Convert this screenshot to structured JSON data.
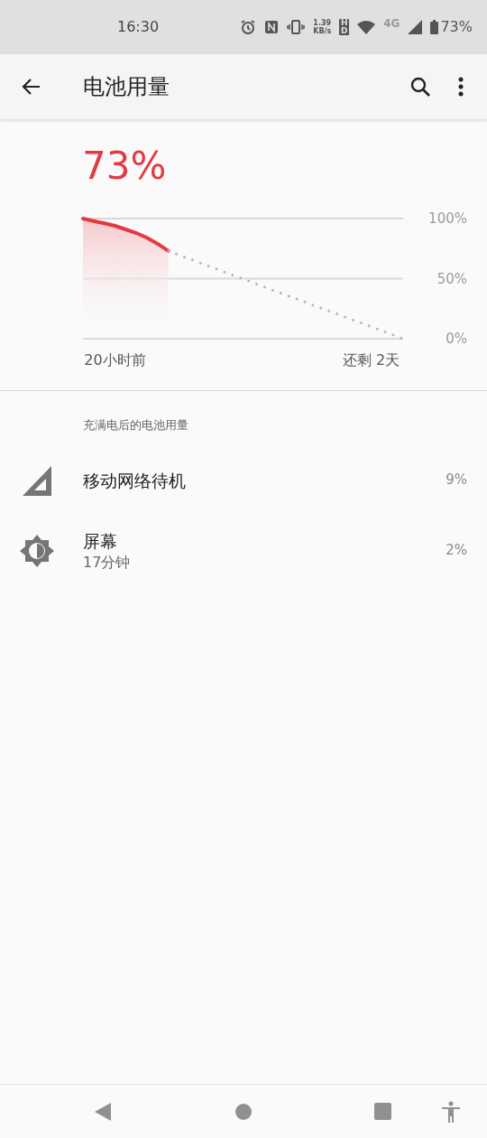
{
  "status_bar": {
    "time": "16:30",
    "speed_value": "1.39",
    "speed_unit": "KB/s",
    "hd": "HD",
    "network": "4G",
    "battery": "73%"
  },
  "app_bar": {
    "title": "电池用量"
  },
  "battery_level": "73%",
  "chart": {
    "chart_data": {
      "type": "line",
      "categories": [
        null,
        null,
        null,
        "20小时前",
        null,
        null,
        null,
        null,
        null,
        null,
        null,
        null,
        null,
        null,
        null,
        null,
        null,
        null,
        null,
        null,
        null,
        null,
        null,
        null,
        null,
        null,
        null,
        "还剩 2天",
        null,
        null,
        null
      ],
      "series": [
        {
          "color": "#e53940",
          "values": [
            100,
            98,
            96,
            94,
            91,
            88,
            84,
            79,
            73,
            null,
            null,
            null,
            null,
            null,
            null,
            null,
            null,
            null,
            null,
            null,
            null,
            null,
            null,
            null,
            null,
            null,
            null,
            null,
            null,
            null,
            null
          ]
        },
        {
          "color": "#b0b8bf",
          "line_style": "dotted",
          "values": [
            null,
            null,
            null,
            null,
            null,
            null,
            null,
            null,
            73,
            69.7,
            66.4,
            63,
            59.7,
            56.4,
            53.1,
            49.8,
            46.5,
            43.1,
            39.8,
            36.5,
            33.2,
            29.9,
            26.5,
            23.2,
            19.9,
            16.6,
            13.3,
            10,
            6.6,
            3.3,
            0
          ]
        }
      ],
      "ylim": [
        0,
        100
      ],
      "yticks": [
        {
          "value": 100,
          "label": "100%"
        },
        {
          "value": 50,
          "label": "50%"
        },
        {
          "value": 0,
          "label": "0%"
        }
      ]
    }
  },
  "section_header": "充满电后的电池用量",
  "usage": [
    {
      "kind": "signal",
      "name": "移动网络待机",
      "percent": "9%"
    },
    {
      "kind": "brightness",
      "name": "屏幕",
      "detail": "17分钟",
      "percent": "2%"
    }
  ]
}
